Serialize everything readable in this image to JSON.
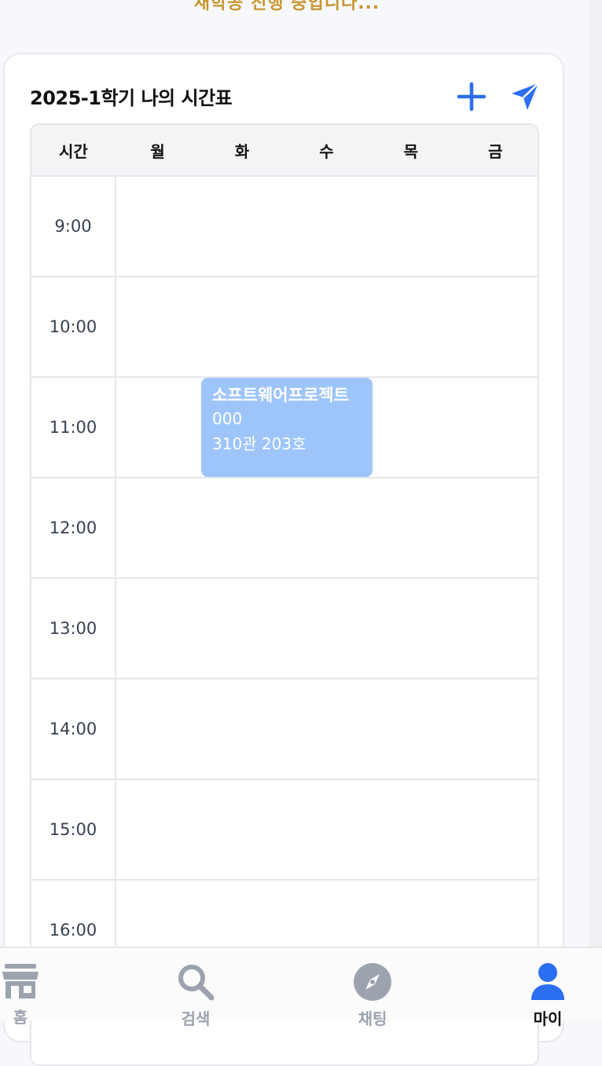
{
  "top_status": {
    "text": "새학공 진행 중입니다..."
  },
  "timetable": {
    "title": "2025-1학기 나의 시간표",
    "header": {
      "time": "시간",
      "days": [
        "월",
        "화",
        "수",
        "목",
        "금"
      ]
    },
    "hours": [
      "9:00",
      "10:00",
      "11:00",
      "12:00",
      "13:00",
      "14:00",
      "15:00",
      "16:00"
    ],
    "courses": [
      {
        "name": "소프트웨어프로젝트",
        "professor": "000",
        "room": "310관 203호",
        "day": "화",
        "start": "11:00",
        "color": "#9ec5fa"
      }
    ]
  },
  "icons": {
    "add": "plus-icon",
    "share": "send-icon"
  },
  "colors": {
    "accent": "#2b6ef2",
    "status_text": "#c9952e",
    "course_block": "#9ec5fa"
  },
  "tabbar": {
    "items": [
      {
        "label": "홈",
        "icon": "store-icon",
        "active": false
      },
      {
        "label": "검색",
        "icon": "search-icon",
        "active": false
      },
      {
        "label": "채팅",
        "icon": "compass-icon",
        "active": false
      },
      {
        "label": "마이",
        "icon": "person-icon",
        "active": true
      }
    ]
  }
}
